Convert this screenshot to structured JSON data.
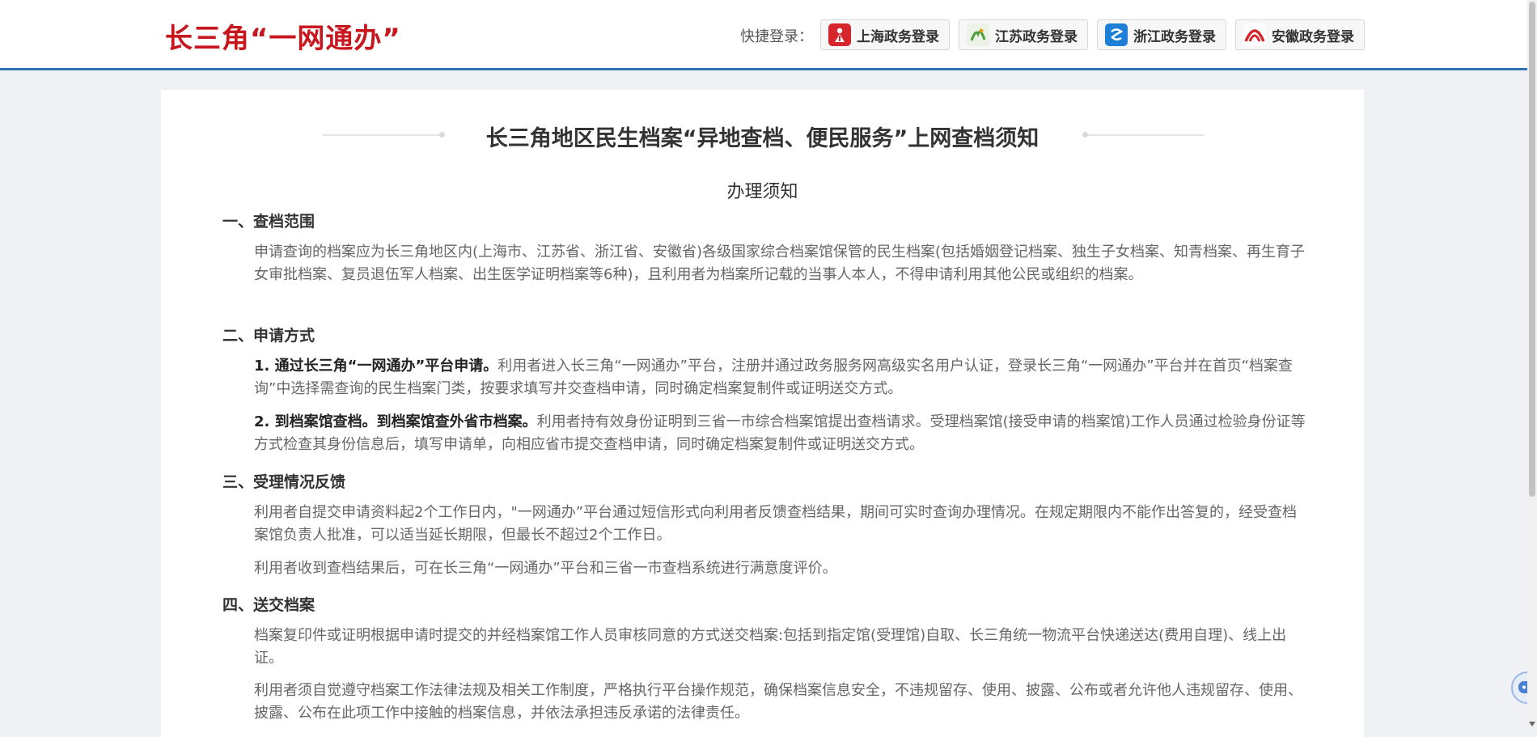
{
  "header": {
    "logo_text": "长三角“一网通办”",
    "quick_login_label": "快捷登录：",
    "logins": [
      {
        "label": "上海政务登录",
        "icon": "shanghai-emblem-icon",
        "color": "#d6262b"
      },
      {
        "label": "江苏政务登录",
        "icon": "jiangsu-emblem-icon",
        "color": "#4a9b3c"
      },
      {
        "label": "浙江政务登录",
        "icon": "zhejiang-emblem-icon",
        "color": "#1e7fd6"
      },
      {
        "label": "安徽政务登录",
        "icon": "anhui-emblem-icon",
        "color": "#d6262b"
      }
    ]
  },
  "notice": {
    "title": "长三角地区民生档案“异地查档、便民服务”上网查档须知",
    "subtitle": "办理须知",
    "sections": [
      {
        "heading": "一、查档范围",
        "paragraphs": [
          "申请查询的档案应为长三角地区内(上海市、江苏省、浙江省、安徽省)各级国家综合档案馆保管的民生档案(包括婚姻登记档案、独生子女档案、知青档案、再生育子女审批档案、复员退伍军人档案、出生医学证明档案等6种)，且利用者为档案所记载的当事人本人，不得申请利用其他公民或组织的档案。"
        ]
      },
      {
        "heading": "二、申请方式",
        "paragraphs": [
          {
            "bold": "1. 通过长三角“一网通办”平台申请。",
            "text": "利用者进入长三角“一网通办”平台，注册并通过政务服务网高级实名用户认证，登录长三角“一网通办”平台并在首页“档案查询”中选择需查询的民生档案门类，按要求填写并交查档申请，同时确定档案复制件或证明送交方式。"
          },
          {
            "bold": "2. 到档案馆查档。到档案馆查外省市档案。",
            "text": "利用者持有效身份证明到三省一市综合档案馆提出查档请求。受理档案馆(接受申请的档案馆)工作人员通过检验身份证等方式检查其身份信息后，填写申请单，向相应省市提交查档申请，同时确定档案复制件或证明送交方式。"
          }
        ]
      },
      {
        "heading": "三、受理情况反馈",
        "paragraphs": [
          "利用者自提交申请资料起2个工作日内，\"一网通办”平台通过短信形式向利用者反馈查档结果，期间可实时查询办理情况。在规定期限内不能作出答复的，经受查档案馆负责人批准，可以适当延长期限，但最长不超过2个工作日。",
          "利用者收到查档结果后，可在长三角“一网通办”平台和三省一市查档系统进行满意度评价。"
        ]
      },
      {
        "heading": "四、送交档案",
        "paragraphs": [
          "档案复印件或证明根据申请时提交的并经档案馆工作人员审核同意的方式送交档案:包括到指定馆(受理馆)自取、长三角统一物流平台快递送达(费用自理)、线上出证。",
          "利用者须自觉遵守档案工作法律法规及相关工作制度，严格执行平台操作规范，确保档案信息安全，不违规留存、使用、披露、公布或者允许他人违规留存、使用、披露、公布在此项工作中接触的档案信息，并依法承担违反承诺的法律责任。"
        ]
      }
    ]
  },
  "widgets": {
    "chat_icon": "chat-robot-icon"
  }
}
